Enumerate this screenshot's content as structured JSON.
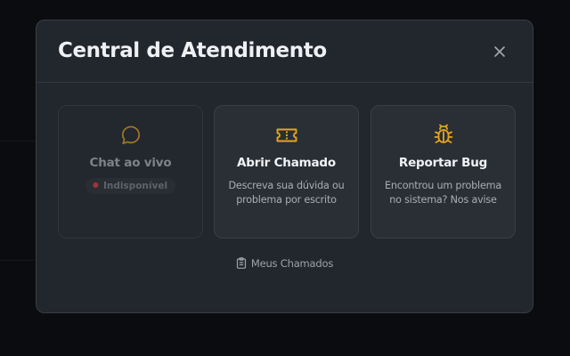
{
  "modal": {
    "title": "Central de Atendimento",
    "close_icon": "close-icon"
  },
  "cards": [
    {
      "icon": "chat-bubble-icon",
      "title": "Chat ao vivo",
      "badge": "Indisponível",
      "status": "disabled"
    },
    {
      "icon": "ticket-icon",
      "title": "Abrir Chamado",
      "description": "Descreva sua dúvida ou problema por escrito"
    },
    {
      "icon": "bug-icon",
      "title": "Reportar Bug",
      "description": "Encontrou um problema no sistema? Nos avise"
    }
  ],
  "footer": {
    "my_tickets_label": "Meus Chamados",
    "icon": "clipboard-icon"
  },
  "colors": {
    "accent": "#e5a51d",
    "accent_dim": "#9a7526",
    "unavailable_dot": "#a2323a",
    "modal_bg": "#22262d"
  }
}
